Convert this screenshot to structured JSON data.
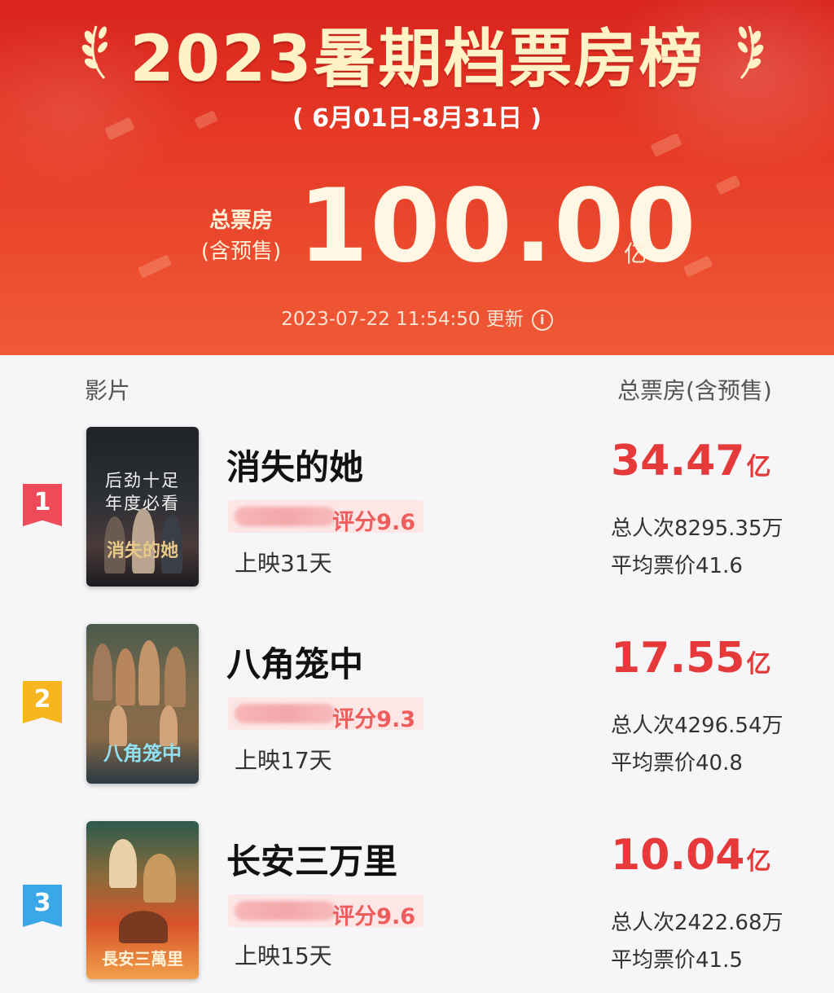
{
  "header": {
    "title": "2023暑期档票房榜",
    "date_range": "( 6月01日-8月31日 )",
    "total_label_line1": "总票房",
    "total_label_line2": "(含预售)",
    "total_value": "100.00",
    "total_unit": "亿",
    "update_time": "2023-07-22 11:54:50 更新",
    "info_icon_glyph": "i"
  },
  "table": {
    "film_header": "影片",
    "box_header": "总票房(含预售)"
  },
  "rank_colors": [
    "#ee4a5a",
    "#f7b620",
    "#3aa7e8"
  ],
  "films": [
    {
      "rank": "1",
      "name": "消失的她",
      "rating": "评分9.6",
      "days": "上映31天",
      "box_value": "34.47",
      "box_unit": "亿",
      "admissions": "总人次8295.35万",
      "avg_price": "平均票价41.6",
      "poster_tagline": "后劲十足 年度必看",
      "poster_title": "消失的她"
    },
    {
      "rank": "2",
      "name": "八角笼中",
      "rating": "评分9.3",
      "days": "上映17天",
      "box_value": "17.55",
      "box_unit": "亿",
      "admissions": "总人次4296.54万",
      "avg_price": "平均票价40.8",
      "poster_tagline": "",
      "poster_title": "八角笼中"
    },
    {
      "rank": "3",
      "name": "长安三万里",
      "rating": "评分9.6",
      "days": "上映15天",
      "box_value": "10.04",
      "box_unit": "亿",
      "admissions": "总人次2422.68万",
      "avg_price": "平均票价41.5",
      "poster_tagline": "",
      "poster_title": "長安三萬里"
    }
  ]
}
